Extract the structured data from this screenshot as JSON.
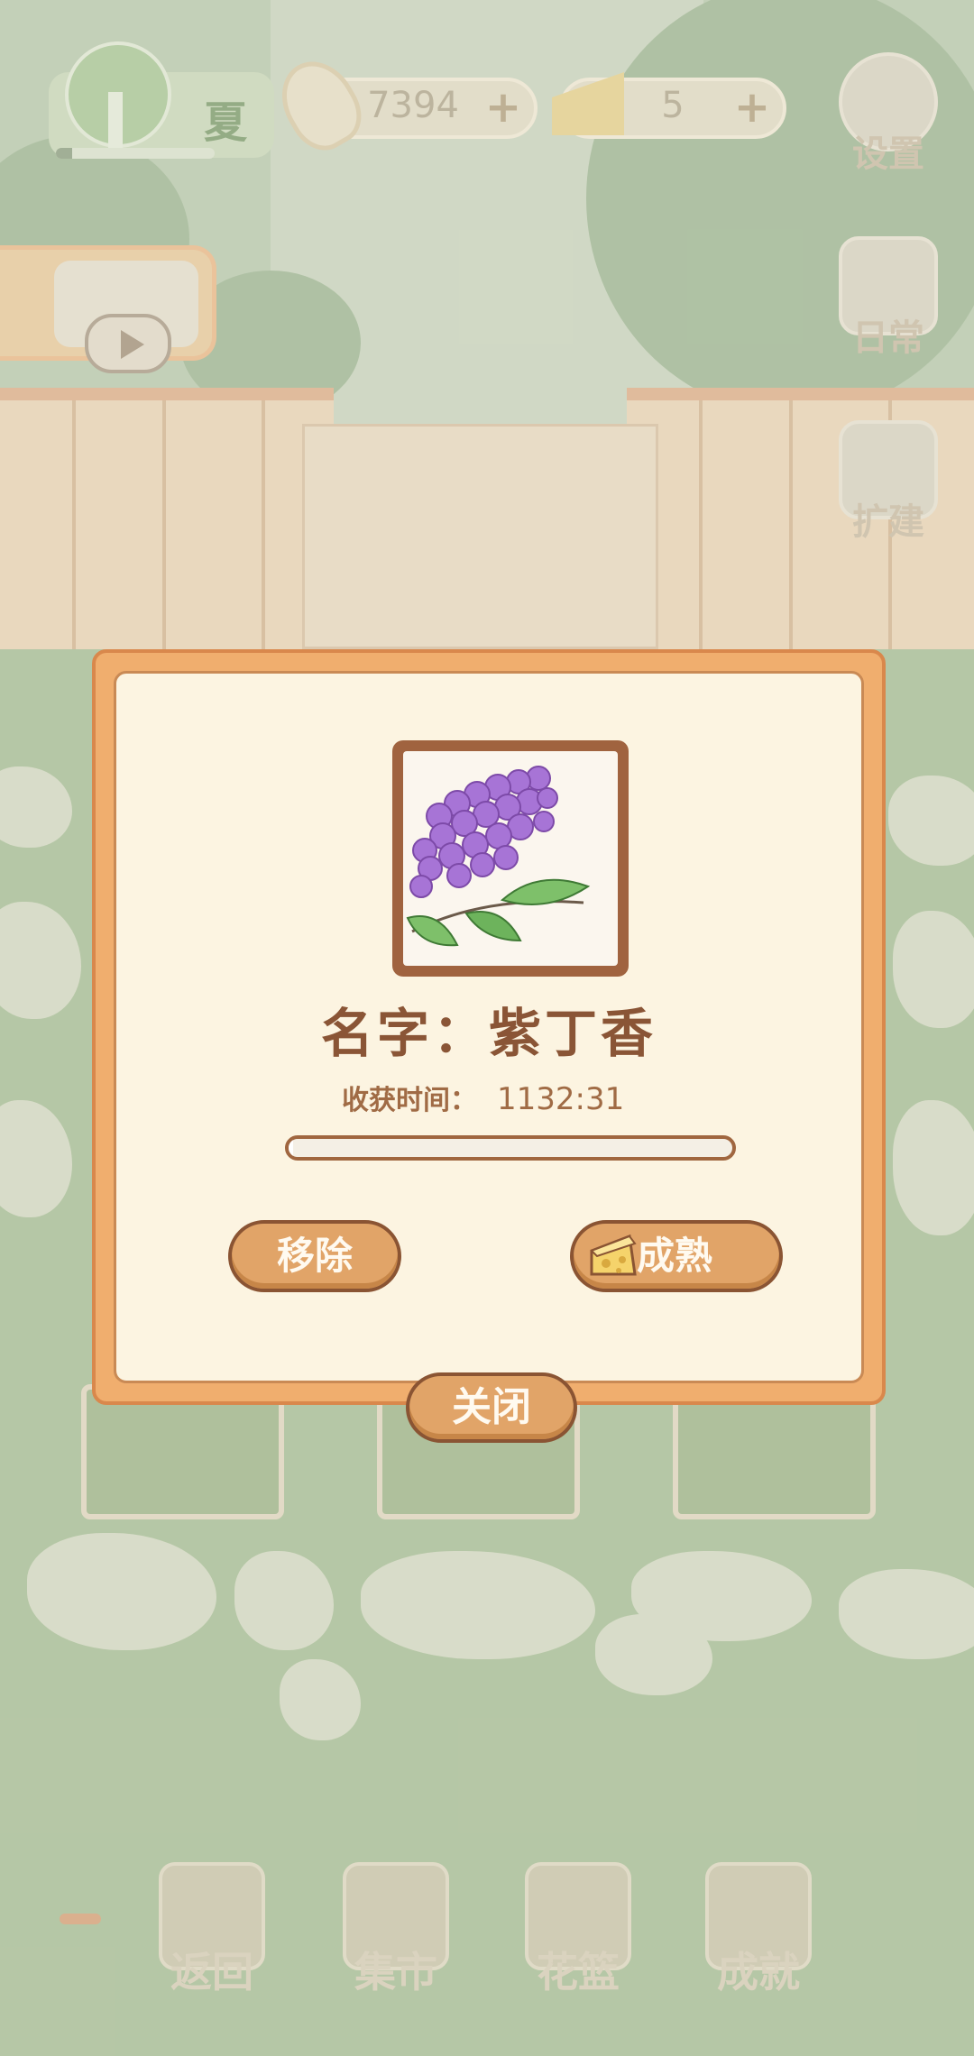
{
  "hud": {
    "season_label": "夏",
    "season_progress": 0.1,
    "fish_count": "7394",
    "cheese_count": "5",
    "plus_symbol": "+"
  },
  "side_menu": {
    "settings_label": "设置",
    "daily_label": "日常",
    "expand_label": "扩建"
  },
  "dialog": {
    "name_text": "名字：紫丁香",
    "harvest_time_label": "收获时间：",
    "harvest_time_value": "1132:31",
    "progress_fraction": 0.01,
    "remove_label": "移除",
    "mature_label": "成熟",
    "close_label": "关闭"
  },
  "bottom_nav": {
    "back_label": "返回",
    "market_label": "集市",
    "basket_label": "花篮",
    "achievement_label": "成就"
  },
  "colors": {
    "dialog_border": "#f0ae6e",
    "dialog_background": "#fcf4e1",
    "button_fill": "#e1a468",
    "text_brown": "#8a5536",
    "grass": "#a7bd96"
  }
}
